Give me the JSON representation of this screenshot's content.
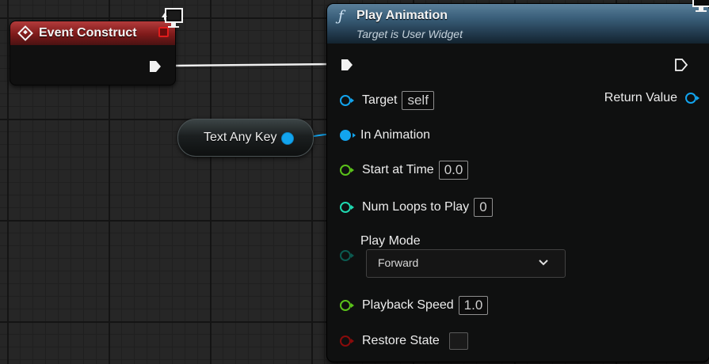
{
  "event_node": {
    "title": "Event Construct"
  },
  "variable_node": {
    "label": "Text Any Key"
  },
  "function_node": {
    "title": "Play Animation",
    "subtitle": "Target is User Widget",
    "pins": {
      "target": {
        "label": "Target",
        "value": "self"
      },
      "return_value": {
        "label": "Return Value"
      },
      "in_animation": {
        "label": "In Animation"
      },
      "start_at_time": {
        "label": "Start at Time",
        "value": "0.0"
      },
      "num_loops": {
        "label": "Num Loops to Play",
        "value": "0"
      },
      "play_mode": {
        "label": "Play Mode",
        "selected": "Forward"
      },
      "playback_speed": {
        "label": "Playback Speed",
        "value": "1.0"
      },
      "restore_state": {
        "label": "Restore State",
        "checked": false
      }
    }
  },
  "icons": [
    "event-icon",
    "function-icon",
    "monitor-icon",
    "chevron-down-icon",
    "exec-pin-icon",
    "delegate-pin-icon"
  ],
  "colors": {
    "event_header": "#7e1a1a",
    "function_header": "#3a5f7a",
    "object_pin": "#12a4ee",
    "float_pin": "#5ac21a",
    "int_pin": "#1fd9b0",
    "enum_pin": "#0b5a50",
    "bool_pin": "#8a0b0b",
    "canvas": "#262626"
  }
}
